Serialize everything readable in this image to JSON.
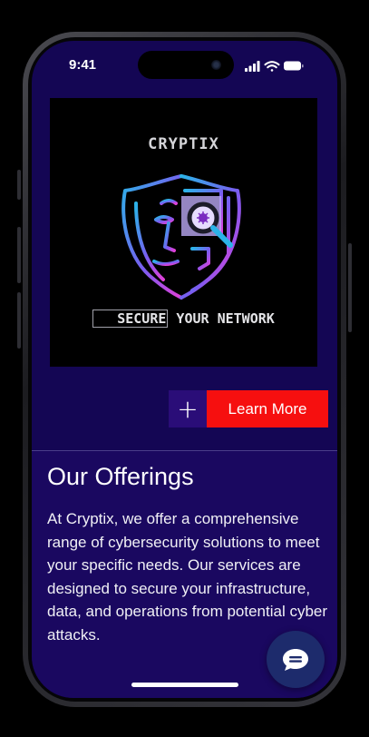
{
  "status_bar": {
    "time": "9:41"
  },
  "hero": {
    "brand": "CRYPTIX",
    "tagline_highlight": "SECURE",
    "tagline_rest": " YOUR NETWORK"
  },
  "cta": {
    "plus_label": "+",
    "learn_more_label": "Learn More"
  },
  "offerings": {
    "title": "Our Offerings",
    "body": "At Cryptix, we offer a comprehensive range of cybersecurity solutions to meet your specific needs. Our services are designed to secure your infrastructure, data, and operations from potential cyber attacks."
  },
  "colors": {
    "screen_bg": "#140654",
    "section_bg": "#1a0860",
    "cta_red": "#f60f0f",
    "plus_bg": "#2a0d78",
    "chat_fab": "#1d2b6c"
  },
  "icons": {
    "signal": "cellular-signal-icon",
    "wifi": "wifi-icon",
    "battery": "battery-icon",
    "chat": "chat-bubble-icon",
    "hero": "shield-face-magnifier-icon"
  }
}
